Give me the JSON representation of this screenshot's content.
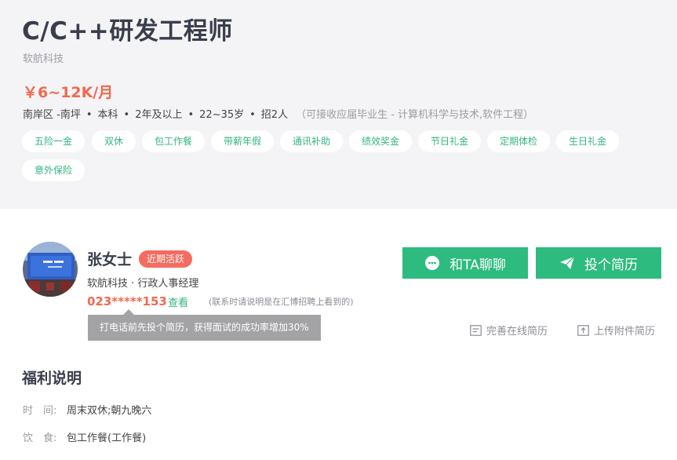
{
  "job": {
    "title": "C/C++研发工程师",
    "company": "软航科技",
    "salary": "￥6~12K/月",
    "meta": {
      "location": "南岸区 -南坪",
      "education": "本科",
      "experience": "2年及以上",
      "age": "22~35岁",
      "headcount": "招2人",
      "note": "（可接收应届毕业生 - 计算机科学与技术,软件工程）"
    },
    "tags": [
      "五险一金",
      "双休",
      "包工作餐",
      "带薪年假",
      "通讯补助",
      "绩效奖金",
      "节日礼金",
      "定期体检",
      "生日礼金",
      "意外保险"
    ]
  },
  "recruiter": {
    "name": "张女士",
    "badge": "近期活跃",
    "role": "软航科技 · 行政人事经理",
    "phone": "023*****153",
    "view_label": "查看",
    "phone_note": "(联系时请说明是在汇博招聘上看到的)",
    "tip": "打电话前先投个简历，获得面试的成功率增加30%"
  },
  "actions": {
    "chat_label": "和TA聊聊",
    "apply_label": "投个简历",
    "online_resume_label": "完善在线简历",
    "attach_resume_label": "上传附件简历"
  },
  "benefits": {
    "section_title": "福利说明",
    "items": [
      {
        "label": "时　间:",
        "value": "周末双休;朝九晚六"
      },
      {
        "label": "饮　食:",
        "value": "包工作餐(工作餐)"
      }
    ]
  },
  "colors": {
    "accent_green": "#2ebb7f",
    "salary_orange": "#f2694f",
    "badge_red": "#f56b5f"
  },
  "icons": {
    "chat": "chat-bubble-icon",
    "apply": "paper-plane-icon",
    "online_resume": "document-icon",
    "attach_resume": "upload-icon"
  }
}
